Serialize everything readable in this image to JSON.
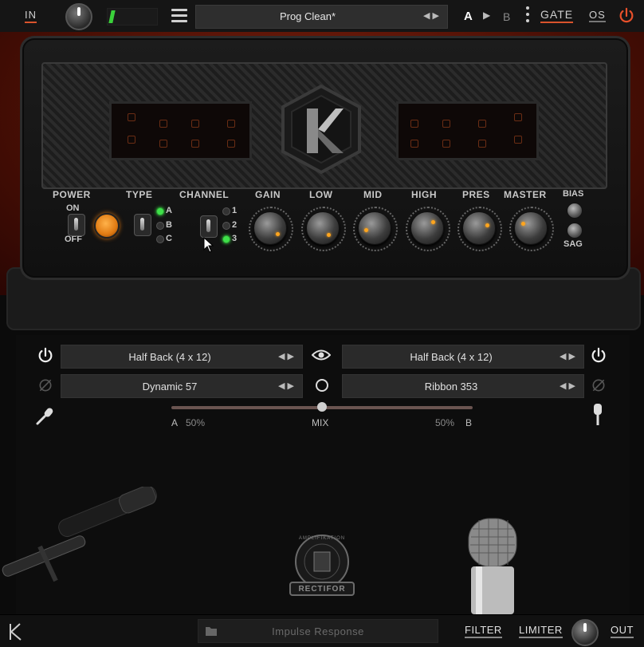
{
  "topbar": {
    "in_label": "IN",
    "menu_icon": "hamburger-menu-icon",
    "preset": "Prog Clean*",
    "preset_arrows": "◀ ▶",
    "ab_a": "A",
    "ab_play": "▶",
    "ab_b": "B",
    "gate_label": "GATE",
    "os_label": "OS",
    "power_icon": "power-icon",
    "accent": "#d9532c"
  },
  "amp": {
    "power_label": "POWER",
    "on_label": "ON",
    "off_label": "OFF",
    "type_label": "TYPE",
    "type_options": [
      "A",
      "B",
      "C"
    ],
    "type_selected": "A",
    "channel_label": "CHANNEL",
    "channel_options": [
      "1",
      "2",
      "3"
    ],
    "channel_selected": "3",
    "knobs": [
      "GAIN",
      "LOW",
      "MID",
      "HIGH",
      "PRES",
      "MASTER"
    ],
    "bias_label": "BIAS",
    "sag_label": "SAG",
    "led_color": "#3fe04a",
    "lamp_color": "#e07a12"
  },
  "cab": {
    "left_cab": "Half Back (4 x 12)",
    "left_mic": "Dynamic 57",
    "right_cab": "Half Back (4 x 12)",
    "right_mic": "Ribbon 353",
    "selector_arrows": "◀ ▶",
    "mix": {
      "a_label": "A",
      "a_value": "50%",
      "mix_label": "MIX",
      "b_value": "50%",
      "b_label": "B",
      "position": 0.5
    },
    "brand_top": "AMPLIFIKATION",
    "brand_bottom": "RECTIFOR"
  },
  "bottombar": {
    "ir_label": "Impulse Response",
    "filter_label": "FILTER",
    "limiter_label": "LIMITER",
    "out_label": "OUT"
  }
}
